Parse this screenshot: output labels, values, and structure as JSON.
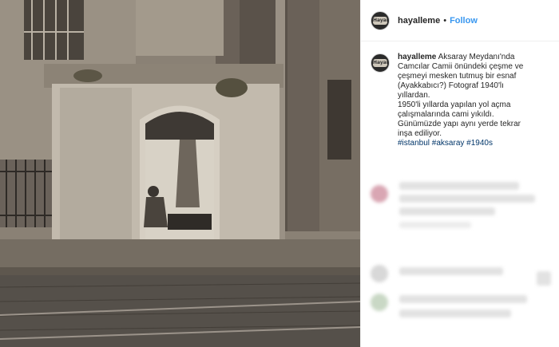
{
  "post": {
    "username": "hayalleme",
    "separator": "•",
    "follow_label": "Follow",
    "avatar_text": "Hayal"
  },
  "caption": {
    "username": "hayalleme",
    "lines": [
      "Aksaray Meydanı'nda",
      "Camcılar Camii önündeki çeşme ve",
      "çeşmeyi mesken tutmuş bir esnaf",
      "(Ayakkabıcı?) Fotograf 1940'lı",
      "yıllardan.",
      "1950'li yıllarda yapılan yol açma",
      "çalışmalarında cami yıkıldı.",
      "Günümüzde yapı aynı yerde tekrar",
      "inşa ediliyor."
    ],
    "hashtags": "#istanbul #aksaray #1940s"
  },
  "colors": {
    "link_blue": "#3897f0",
    "hashtag_blue": "#003569",
    "text": "#262626",
    "border": "#efefef"
  }
}
